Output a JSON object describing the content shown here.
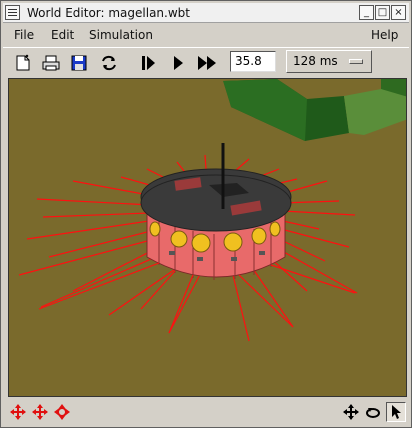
{
  "window": {
    "title": "World Editor: magellan.wbt",
    "menu_icon": "window-menu-icon",
    "buttons": {
      "minimize": "_",
      "maximize": "□",
      "close": "×"
    }
  },
  "menubar": {
    "items": [
      "File",
      "Edit",
      "Simulation"
    ],
    "help": "Help"
  },
  "toolbar": {
    "icons": [
      "new-file-icon",
      "print-icon",
      "save-icon",
      "reload-icon",
      "step-icon",
      "play-icon",
      "fast-forward-icon"
    ],
    "simulation_time": "35.8",
    "time_step": "128 ms"
  },
  "scene": {
    "ground_color": "#7a6a2c",
    "wall_color": "#1f5a1a",
    "robot_body_color": "#e86a6a",
    "robot_top_color": "#3a3a3a",
    "sensor_ray_color": "#ff1010",
    "sensor_color": "#f0c020"
  },
  "statusbar": {
    "left_icons": [
      "move-x-icon",
      "move-y-icon",
      "move-z-icon"
    ],
    "right_icons": [
      "translate-view-icon",
      "rotate-view-icon",
      "select-pointer-icon"
    ]
  }
}
